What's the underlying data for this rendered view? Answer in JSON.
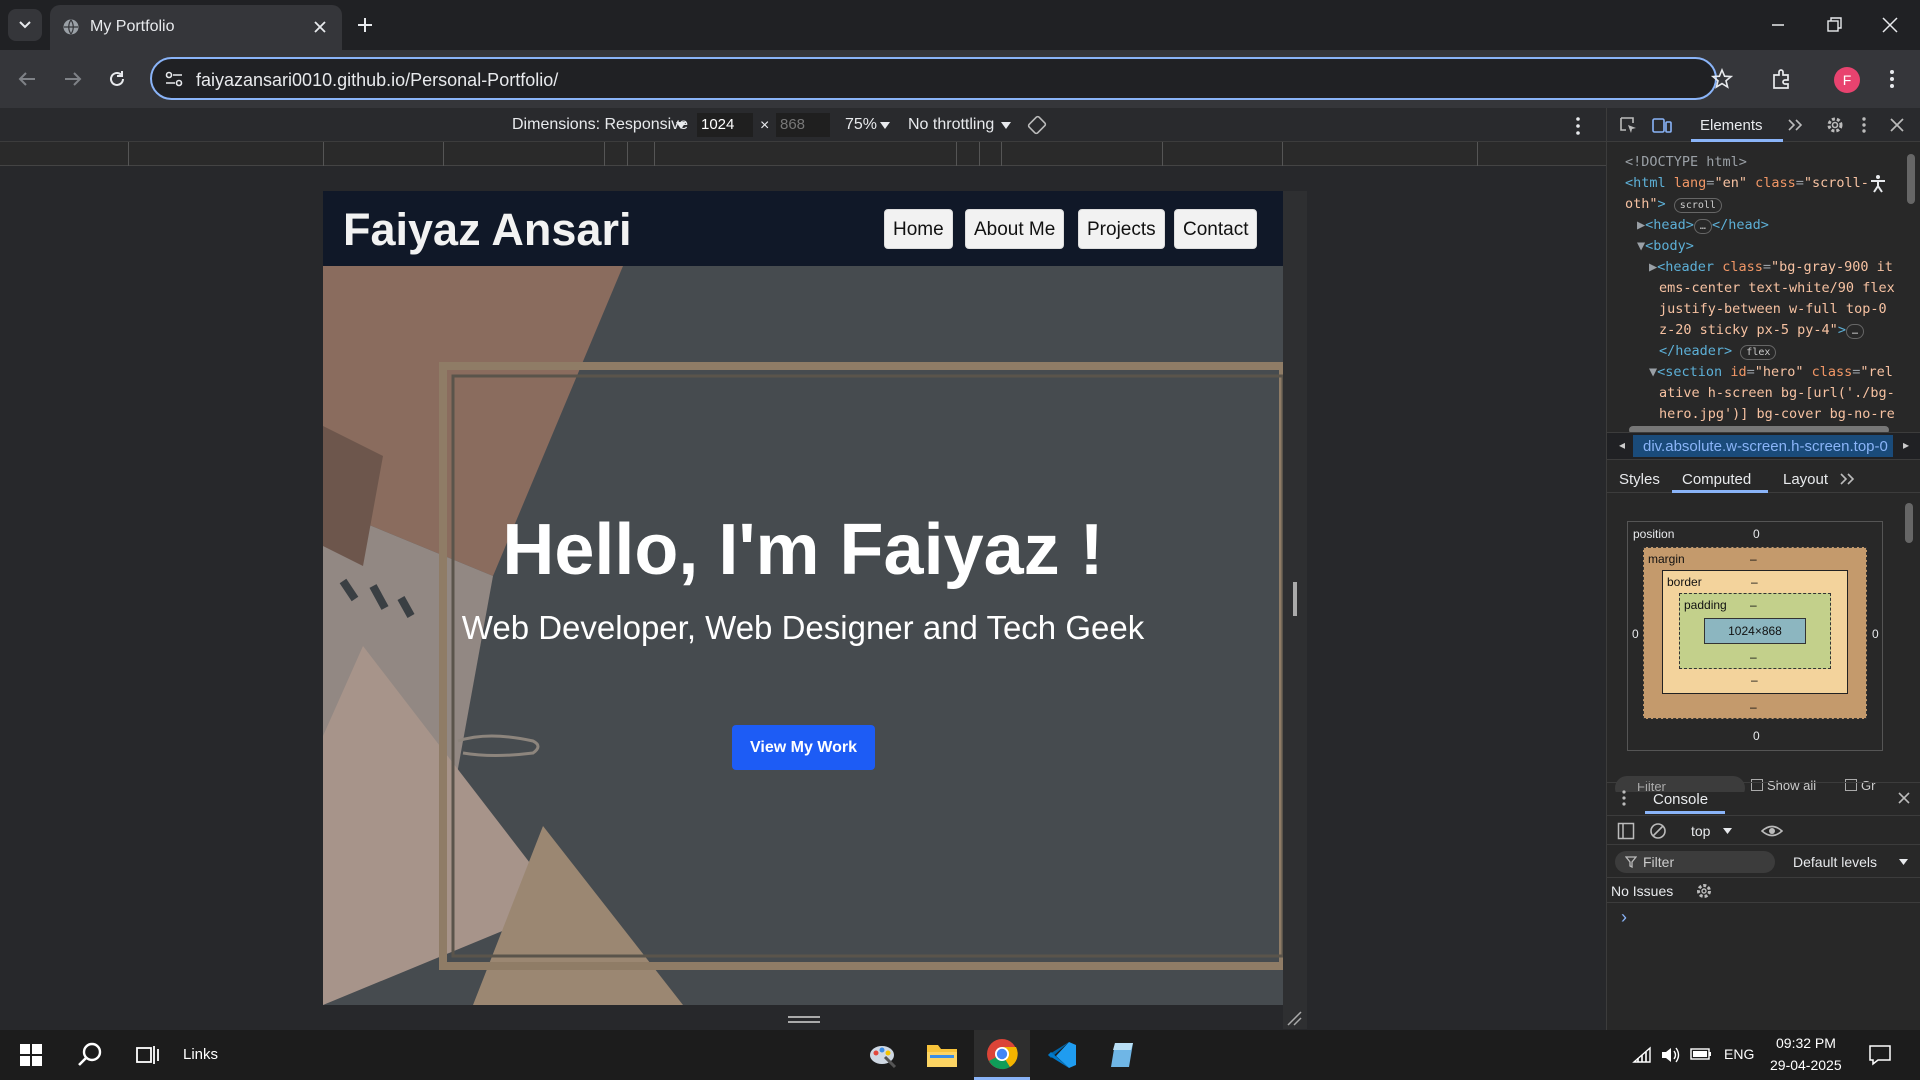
{
  "browser": {
    "tab_title": "My Portfolio",
    "url": "faiyazansari0010.github.io/Personal-Portfolio/",
    "profile_initial": "F"
  },
  "device_toolbar": {
    "dimensions_label": "Dimensions: Responsive",
    "width": "1024",
    "height": "868",
    "zoom": "75%",
    "throttling": "No throttling",
    "times": "×"
  },
  "page": {
    "brand": "Faiyaz Ansari",
    "nav": [
      "Home",
      "About Me",
      "Projects",
      "Contact"
    ],
    "hero_title": "Hello, I'm Faiyaz !",
    "hero_subtitle": "Web Developer, Web Designer and Tech Geek",
    "cta": "View My Work"
  },
  "devtools": {
    "tabs": {
      "elements": "Elements"
    },
    "breadcrumb": "div.absolute.w-screen.h-screen.top-0",
    "subtabs": [
      "Styles",
      "Computed",
      "Layout"
    ],
    "box_model": {
      "position": "position",
      "position_val": "0",
      "margin": "margin",
      "border": "border",
      "padding": "padding",
      "dash": "–",
      "content": "1024×868",
      "zero": "0"
    },
    "filter_cut": "Filter",
    "show_all_cut": "Show all",
    "gr_cut": "Gr",
    "console": {
      "title": "Console",
      "context": "top",
      "filter": "Filter",
      "levels": "Default levels",
      "issues": "No Issues",
      "prompt": "›"
    }
  },
  "taskbar": {
    "links": "Links",
    "lang": "ENG",
    "time": "09:32 PM",
    "date": "29-04-2025"
  }
}
